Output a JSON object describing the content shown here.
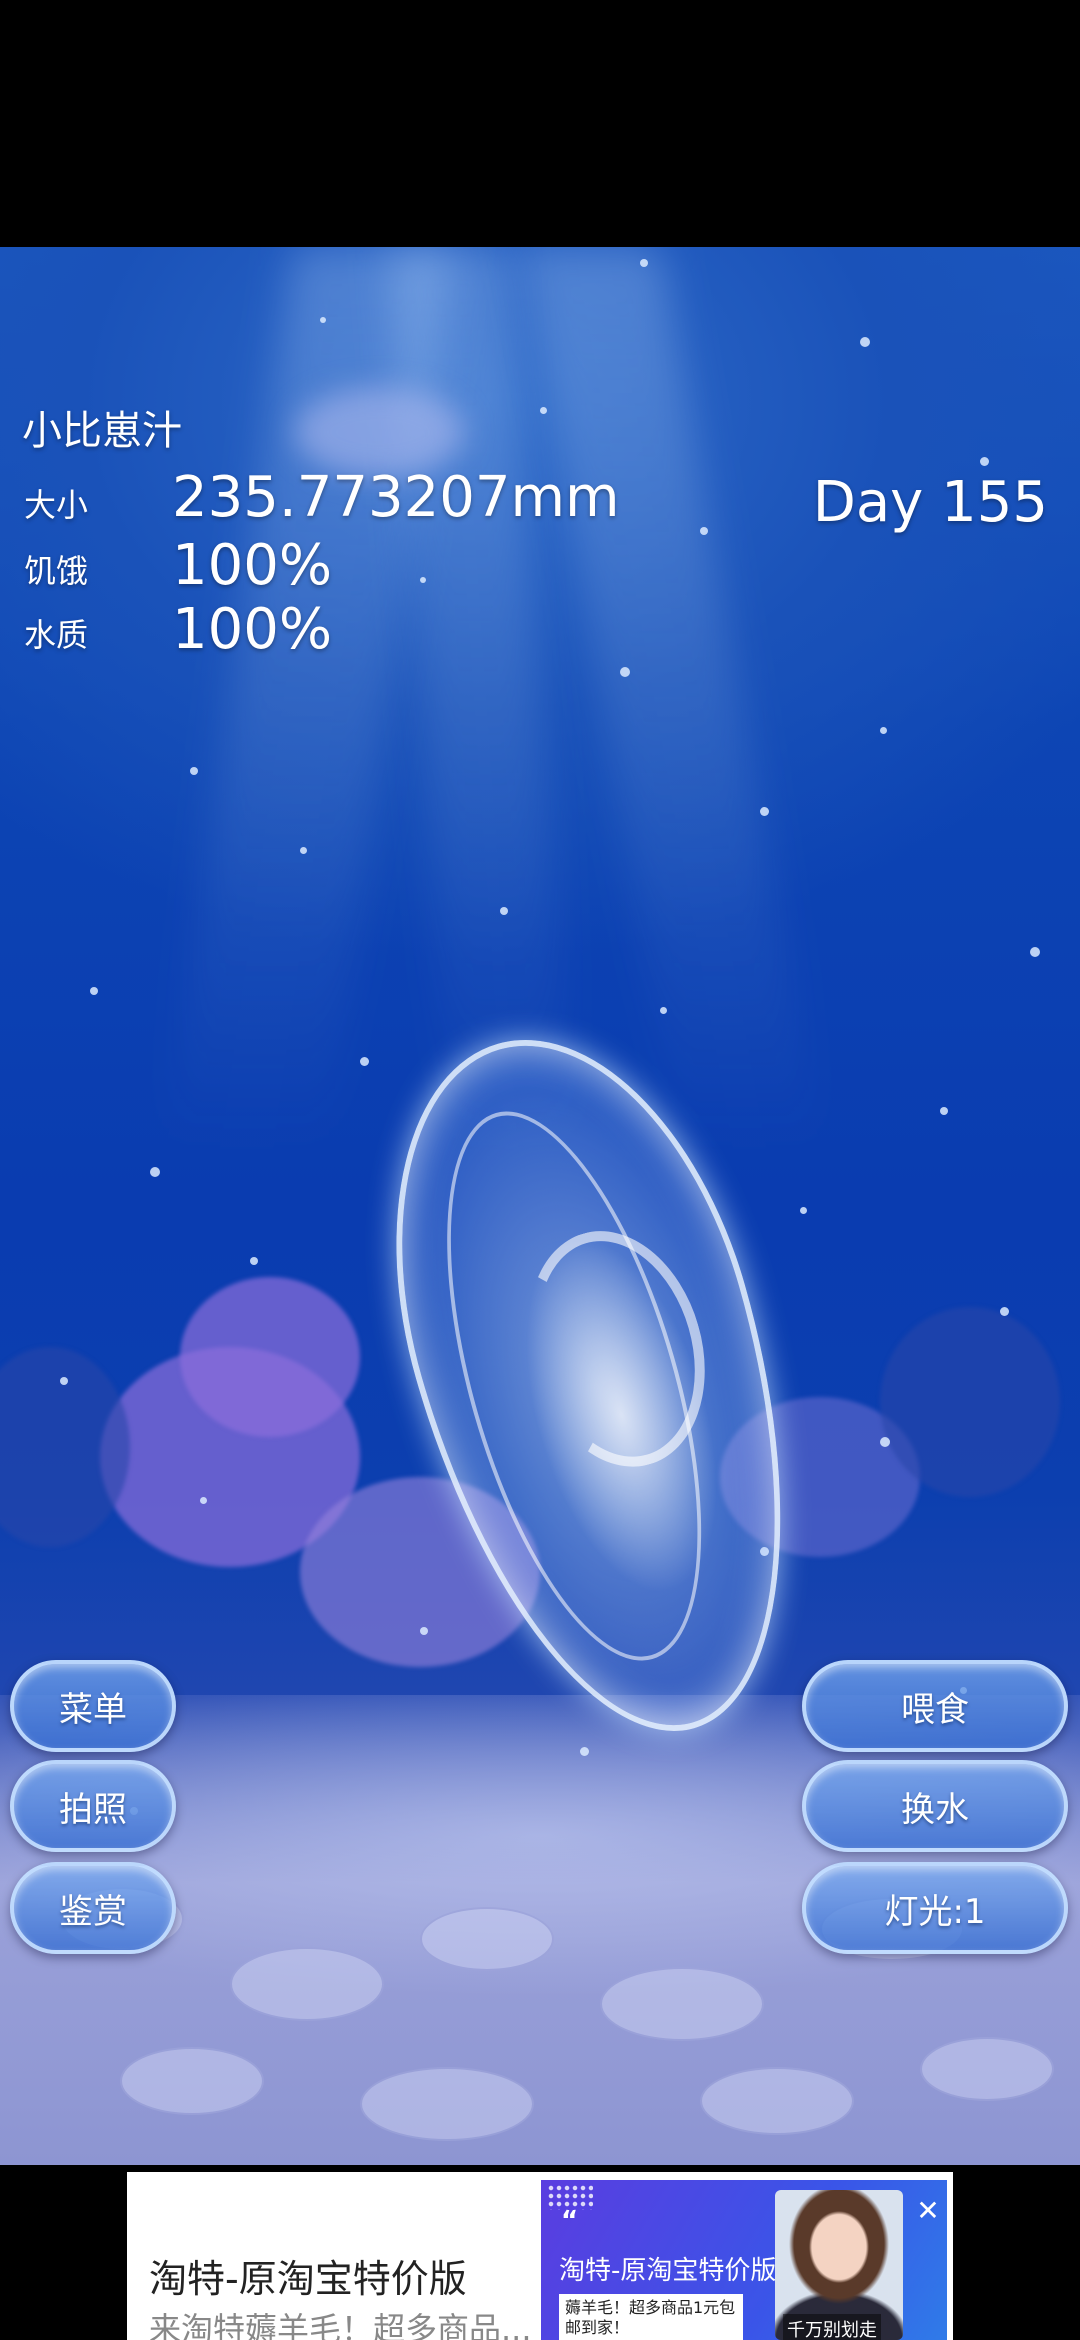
{
  "pet": {
    "name": "小比崽汁",
    "day": "Day 155"
  },
  "stats": [
    {
      "label": "大小",
      "value": "235.773207mm"
    },
    {
      "label": "饥饿",
      "value": "100%"
    },
    {
      "label": "水质",
      "value": "100%"
    }
  ],
  "left_buttons": [
    {
      "label": "菜单"
    },
    {
      "label": "拍照"
    },
    {
      "label": "鉴赏"
    }
  ],
  "right_buttons": [
    {
      "label": "喂食"
    },
    {
      "label": "换水"
    },
    {
      "label": "灯光:1"
    }
  ],
  "ad": {
    "title": "淘特-原淘宝特价版",
    "description": "来淘特薅羊毛！超多商品...",
    "image_quote": "“",
    "image_title": "淘特-原淘宝特价版",
    "image_subtitle": "薅羊毛！超多商品1元包邮到家！",
    "image_caption": "千万别划走",
    "close_icon": "close-icon"
  },
  "colors": {
    "water_top": "#1b58c0",
    "water_mid": "#0a3cb0",
    "button_border": "#c8e1ff",
    "ad_image_bg": "#3a55e8"
  }
}
